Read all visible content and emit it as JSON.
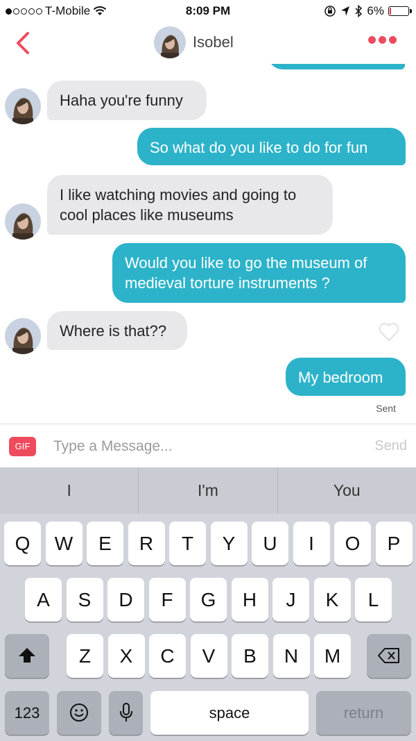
{
  "status_bar": {
    "carrier": "T-Mobile",
    "signal_bars_filled": 1,
    "signal_bars_total": 5,
    "time": "8:09 PM",
    "battery_text": "6%",
    "battery_level": 0.06,
    "battery_color": "#e8333a",
    "icons": [
      "wifi-icon",
      "orientation-lock-icon",
      "location-icon",
      "bluetooth-icon",
      "battery-icon"
    ]
  },
  "header": {
    "back_icon": "chevron-left-icon",
    "name": "Isobel",
    "more_icon": "more-dots-icon",
    "accent_color": "#ee4b5e"
  },
  "messages": [
    {
      "direction": "in",
      "text": "Haha you're funny"
    },
    {
      "direction": "out",
      "text": "So what do you like to do for fun"
    },
    {
      "direction": "in",
      "text": "I like watching movies and going to cool places like museums"
    },
    {
      "direction": "out",
      "text": "Would you like to go the museum of medieval torture instruments ?"
    },
    {
      "direction": "in",
      "text": "Where is that??"
    },
    {
      "direction": "out",
      "text": "My bedroom"
    }
  ],
  "status_text": "Sent",
  "colors": {
    "outgoing_bubble": "#2db3c9",
    "incoming_bubble": "#e8e8ea"
  },
  "input": {
    "gif_label": "GIF",
    "placeholder": "Type a Message...",
    "value": "",
    "send_label": "Send"
  },
  "keyboard": {
    "suggestions": [
      "I",
      "I'm",
      "You"
    ],
    "row1": [
      "Q",
      "W",
      "E",
      "R",
      "T",
      "Y",
      "U",
      "I",
      "O",
      "P"
    ],
    "row2": [
      "A",
      "S",
      "D",
      "F",
      "G",
      "H",
      "J",
      "K",
      "L"
    ],
    "row3": [
      "Z",
      "X",
      "C",
      "V",
      "B",
      "N",
      "M"
    ],
    "numbers_label": "123",
    "space_label": "space",
    "return_label": "return"
  }
}
